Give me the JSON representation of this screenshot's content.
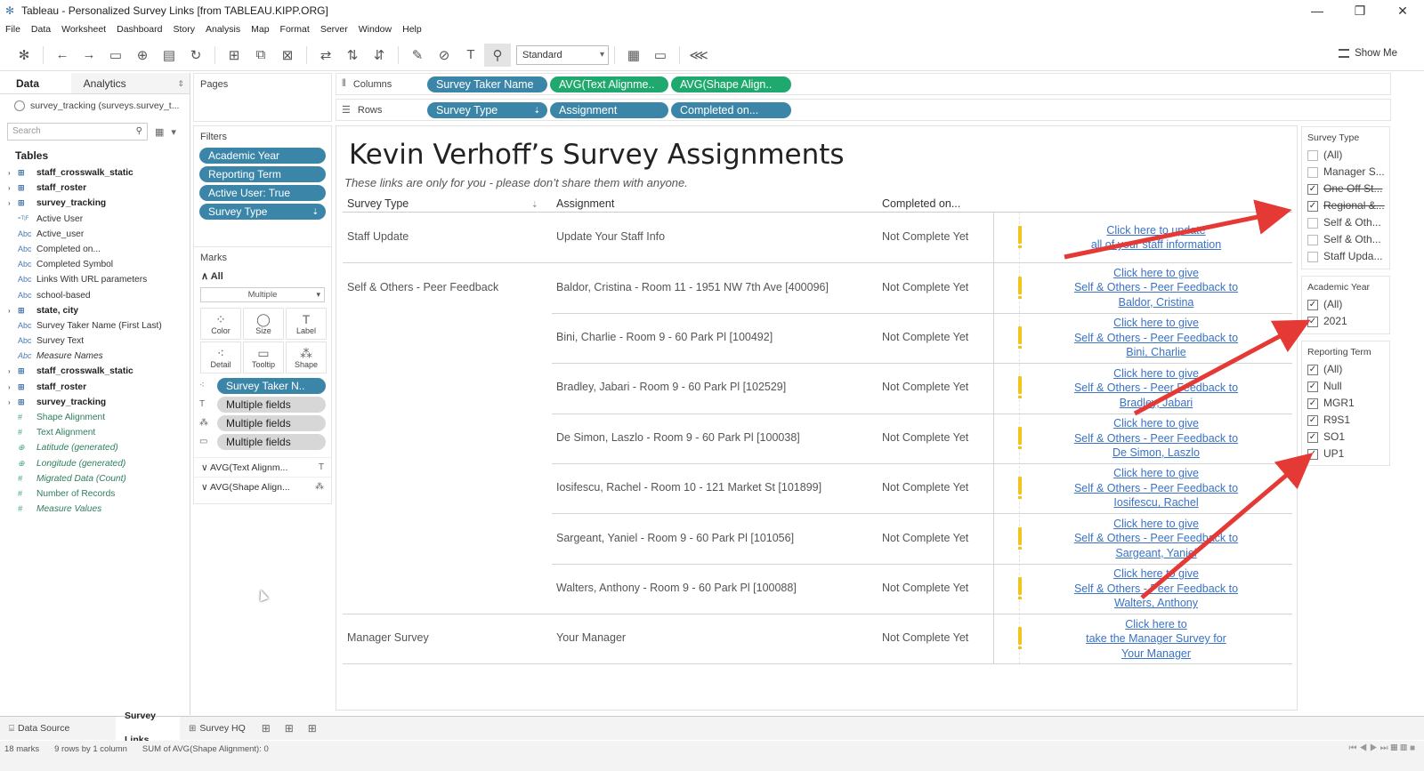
{
  "window": {
    "title": "Tableau - Personalized Survey Links [from TABLEAU.KIPP.ORG]",
    "controls": [
      "—",
      "❐",
      "✕"
    ]
  },
  "menu": [
    "File",
    "Data",
    "Worksheet",
    "Dashboard",
    "Story",
    "Analysis",
    "Map",
    "Format",
    "Server",
    "Window",
    "Help"
  ],
  "toolbar": {
    "fit_select": "Standard",
    "show_me": "Show Me"
  },
  "data_pane": {
    "tabs": [
      "Data",
      "Analytics"
    ],
    "datasource": "survey_tracking (surveys.survey_t...",
    "search_placeholder": "Search",
    "tables_heading": "Tables",
    "fields": [
      {
        "label": "staff_crosswalk_static",
        "type": "table"
      },
      {
        "label": "staff_roster",
        "type": "table"
      },
      {
        "label": "survey_tracking",
        "type": "table"
      },
      {
        "label": "Active User",
        "type": "calc"
      },
      {
        "label": "Active_user",
        "type": "abc"
      },
      {
        "label": "Completed on...",
        "type": "abc"
      },
      {
        "label": "Completed Symbol",
        "type": "abc"
      },
      {
        "label": "Links With URL parameters",
        "type": "abc"
      },
      {
        "label": "school-based",
        "type": "abc"
      },
      {
        "label": "state, city",
        "type": "table"
      },
      {
        "label": "Survey Taker Name (First Last)",
        "type": "abc"
      },
      {
        "label": "Survey Text",
        "type": "abc"
      },
      {
        "label": "Measure Names",
        "type": "abc-italic"
      },
      {
        "label": "staff_crosswalk_static",
        "type": "table"
      },
      {
        "label": "staff_roster",
        "type": "table"
      },
      {
        "label": "survey_tracking",
        "type": "table"
      },
      {
        "label": "Shape Alignment",
        "type": "measure"
      },
      {
        "label": "Text Alignment",
        "type": "measure"
      },
      {
        "label": "Latitude (generated)",
        "type": "geo"
      },
      {
        "label": "Longitude (generated)",
        "type": "geo"
      },
      {
        "label": "Migrated Data (Count)",
        "type": "measure-italic"
      },
      {
        "label": "Number of Records",
        "type": "measure"
      },
      {
        "label": "Measure Values",
        "type": "measure-italic"
      }
    ]
  },
  "pages_card": {
    "title": "Pages"
  },
  "filters_card": {
    "title": "Filters",
    "pills": [
      "Academic Year",
      "Reporting Term",
      "Active User: True",
      "Survey Type"
    ]
  },
  "marks_card": {
    "title": "Marks",
    "all_label": "All",
    "mark_type": "Multiple",
    "buttons": [
      "Color",
      "Size",
      "Label",
      "Detail",
      "Tooltip",
      "Shape"
    ],
    "pills": [
      "Survey Taker N..",
      "Multiple fields",
      "Multiple fields",
      "Multiple fields"
    ],
    "measures": [
      "AVG(Text Alignm...",
      "AVG(Shape Align..."
    ]
  },
  "columns_shelf": {
    "label": "Columns",
    "pills": [
      "Survey Taker Name",
      "AVG(Text Alignme..",
      "AVG(Shape Align.."
    ]
  },
  "rows_shelf": {
    "label": "Rows",
    "pills": [
      "Survey Type",
      "Assignment",
      "Completed on..."
    ]
  },
  "viz": {
    "title": "Kevin Verhoff’s Survey Assignments",
    "subtitle": "These links are only for you - please don’t share them with anyone.",
    "headers": [
      "Survey Type",
      "Assignment",
      "Completed on..."
    ],
    "rows": [
      {
        "type": "Staff Update",
        "assignment": "Update Your Staff Info",
        "completed": "Not Complete Yet",
        "link": [
          "Click here to update",
          "all of your staff information"
        ]
      },
      {
        "type": "Self & Others - Peer Feedback",
        "assignment": "Baldor, Cristina - Room 11 - 1951 NW 7th Ave [400096]",
        "completed": "Not Complete Yet",
        "link": [
          "Click here to give",
          "Self & Others - Peer Feedback to",
          "Baldor, Cristina"
        ]
      },
      {
        "type": "",
        "assignment": "Bini, Charlie - Room 9 - 60 Park Pl [100492]",
        "completed": "Not Complete Yet",
        "link": [
          "Click here to give",
          "Self & Others - Peer Feedback to",
          "Bini, Charlie"
        ]
      },
      {
        "type": "",
        "assignment": "Bradley, Jabari - Room 9 - 60 Park Pl [102529]",
        "completed": "Not Complete Yet",
        "link": [
          "Click here to give",
          "Self & Others - Peer Feedback to",
          "Bradley, Jabari"
        ]
      },
      {
        "type": "",
        "assignment": "De Simon, Laszlo - Room 9 - 60 Park Pl [100038]",
        "completed": "Not Complete Yet",
        "link": [
          "Click here to give",
          "Self & Others - Peer Feedback to",
          "De Simon, Laszlo"
        ]
      },
      {
        "type": "",
        "assignment": "Iosifescu, Rachel - Room 10 - 121 Market St [101899]",
        "completed": "Not Complete Yet",
        "link": [
          "Click here to give",
          "Self & Others - Peer Feedback to",
          "Iosifescu, Rachel"
        ]
      },
      {
        "type": "",
        "assignment": "Sargeant, Yaniel - Room 9 - 60 Park Pl [101056]",
        "completed": "Not Complete Yet",
        "link": [
          "Click here to give",
          "Self & Others - Peer Feedback to",
          "Sargeant, Yaniel"
        ]
      },
      {
        "type": "",
        "assignment": "Walters, Anthony - Room 9 - 60 Park Pl [100088]",
        "completed": "Not Complete Yet",
        "link": [
          "Click here to give",
          "Self & Others - Peer Feedback to",
          "Walters, Anthony"
        ]
      },
      {
        "type": "Manager Survey",
        "assignment": "Your Manager",
        "completed": "Not Complete Yet",
        "link": [
          "Click here to",
          "take the Manager Survey for",
          "Your Manager"
        ]
      }
    ]
  },
  "filter_panels": [
    {
      "title": "Survey Type",
      "items": [
        {
          "label": "(All)",
          "checked": false
        },
        {
          "label": "Manager S...",
          "checked": false
        },
        {
          "label": "One Off St...",
          "checked": true,
          "strike": true
        },
        {
          "label": "Regional &...",
          "checked": true,
          "strike": true
        },
        {
          "label": "Self & Oth...",
          "checked": false
        },
        {
          "label": "Self & Oth...",
          "checked": false
        },
        {
          "label": "Staff Upda...",
          "checked": false
        }
      ]
    },
    {
      "title": "Academic Year",
      "items": [
        {
          "label": "(All)",
          "checked": true
        },
        {
          "label": "2021",
          "checked": true
        }
      ]
    },
    {
      "title": "Reporting Term",
      "items": [
        {
          "label": "(All)",
          "checked": true
        },
        {
          "label": "Null",
          "checked": true
        },
        {
          "label": "MGR1",
          "checked": true
        },
        {
          "label": "R9S1",
          "checked": true
        },
        {
          "label": "SO1",
          "checked": true
        },
        {
          "label": "UP1",
          "checked": true
        }
      ]
    }
  ],
  "sheet_tabs": {
    "data_source": "Data Source",
    "tabs": [
      "Survey Links",
      "Survey HQ"
    ]
  },
  "status": {
    "marks": "18 marks",
    "dims": "9 rows by 1 column",
    "sum": "SUM of AVG(Shape Alignment): 0"
  },
  "accent_colors": {
    "dimension_pill": "#3b86a8",
    "measure_pill": "#20a96f",
    "arrow": "#e53935",
    "link": "#3a72c4"
  }
}
